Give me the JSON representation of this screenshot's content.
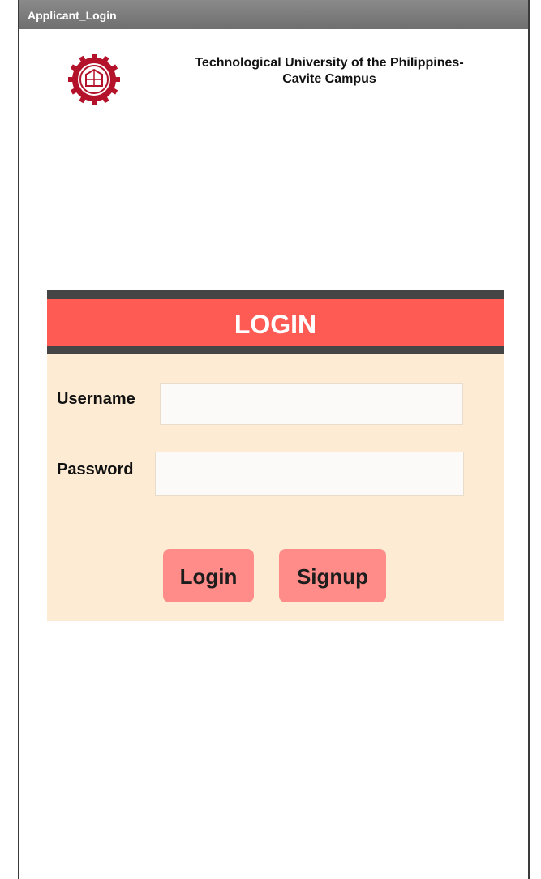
{
  "window": {
    "title": "Applicant_Login"
  },
  "header": {
    "logo_icon": "university-seal-icon",
    "university_name_line1": "Technological University of the Philippines-",
    "university_name_line2": "Cavite Campus"
  },
  "login": {
    "heading": "LOGIN",
    "username_label": "Username",
    "username_value": "",
    "password_label": "Password",
    "password_value": "",
    "login_button": "Login",
    "signup_button": "Signup"
  },
  "colors": {
    "header_red": "#ff5b55",
    "panel_bg": "#fdebd3",
    "button_pink": "#ff8c89",
    "dark_bar": "#454545"
  }
}
